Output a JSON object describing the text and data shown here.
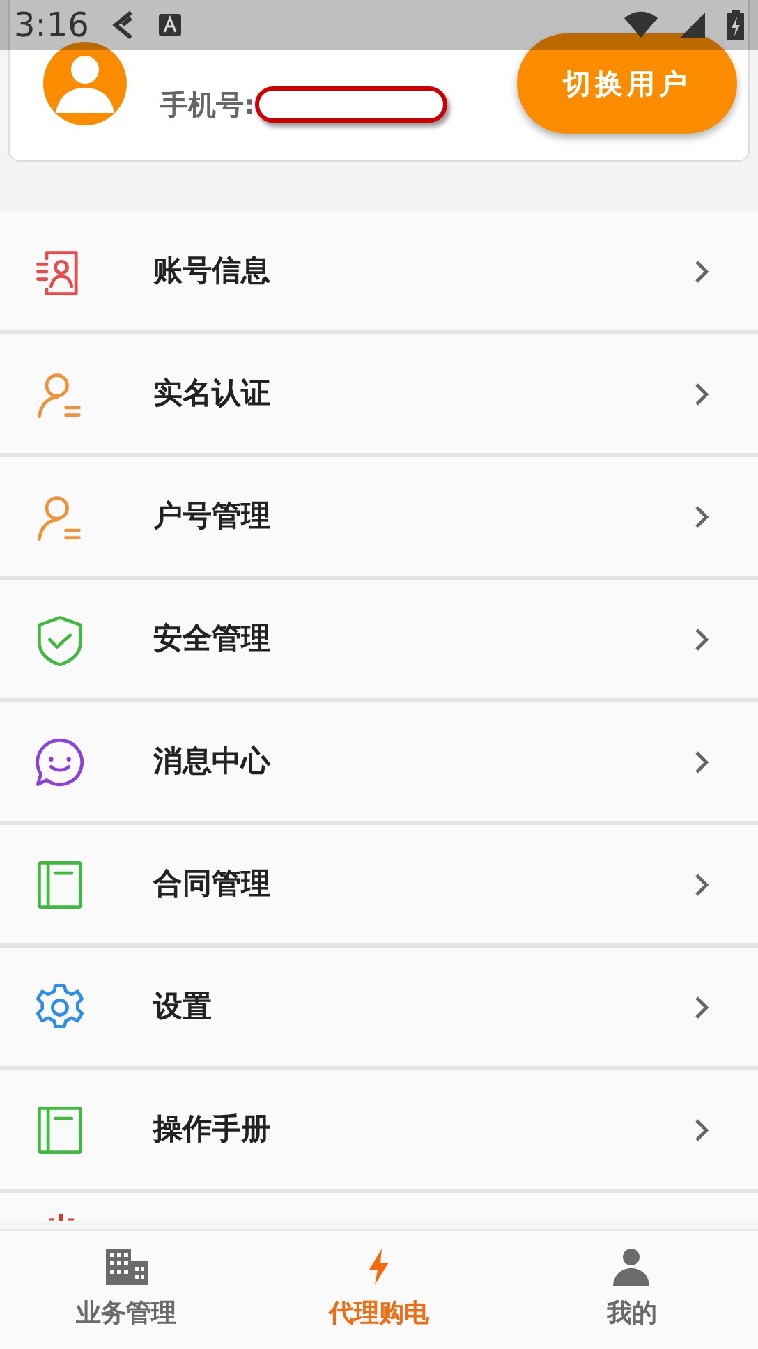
{
  "status_bar": {
    "time": "3:16"
  },
  "profile": {
    "phone_label": "手机号:",
    "switch_button": "切换用户"
  },
  "menu": [
    {
      "label": "账号信息",
      "kind": "id-card",
      "color": "#e94b4b"
    },
    {
      "label": "实名认证",
      "kind": "user-list",
      "color": "#f39234"
    },
    {
      "label": "户号管理",
      "kind": "user-list",
      "color": "#f39234"
    },
    {
      "label": "安全管理",
      "kind": "shield",
      "color": "#3fba3f"
    },
    {
      "label": "消息中心",
      "kind": "chat",
      "color": "#8a3fe0"
    },
    {
      "label": "合同管理",
      "kind": "book",
      "color": "#3fba3f"
    },
    {
      "label": "设置",
      "kind": "gear",
      "color": "#2d8fe8"
    },
    {
      "label": "操作手册",
      "kind": "book",
      "color": "#3fba3f"
    }
  ],
  "bottom_nav": [
    {
      "label": "业务管理",
      "kind": "building",
      "selected": false
    },
    {
      "label": "代理购电",
      "kind": "bolt",
      "selected": true
    },
    {
      "label": "我的",
      "kind": "person",
      "selected": false
    }
  ]
}
